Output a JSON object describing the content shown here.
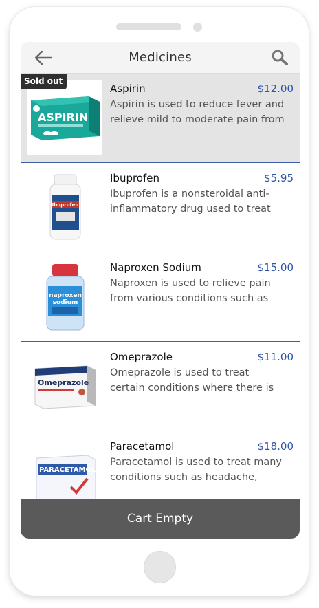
{
  "header": {
    "title": "Medicines",
    "back_icon": "arrow-left-icon",
    "search_icon": "search-icon"
  },
  "items": [
    {
      "name": "Aspirin",
      "price": "$12.00",
      "desc_line1": "Aspirin is used to reduce fever and",
      "desc_line2": "relieve mild to moderate pain from",
      "badge": "Sold out",
      "image_text": "ASPIRIN"
    },
    {
      "name": "Ibuprofen",
      "price": "$5.95",
      "desc_line1": "Ibuprofen is a nonsteroidal anti-",
      "desc_line2": "inflammatory drug used to treat",
      "image_text": "Ibuprofen"
    },
    {
      "name": "Naproxen Sodium",
      "price": "$15.00",
      "desc_line1": "Naproxen is used to relieve pain",
      "desc_line2": "from various conditions such as",
      "image_text_1": "naproxen",
      "image_text_2": "sodium"
    },
    {
      "name": "Omeprazole",
      "price": "$11.00",
      "desc_line1": "Omeprazole is used to treat",
      "desc_line2": "certain conditions where there is",
      "image_text": "Omeprazole"
    },
    {
      "name": "Paracetamol",
      "price": "$18.00",
      "desc_line1": "Paracetamol is used to treat many",
      "desc_line2": "conditions such as headache,",
      "image_text": "PARACETAMOL"
    }
  ],
  "cart": {
    "label": "Cart Empty"
  },
  "colors": {
    "price": "#2f55a8",
    "divider": "#3b5ea6",
    "cart_bar": "#5a5a5a",
    "sold_bg": "#e4e4e4"
  }
}
